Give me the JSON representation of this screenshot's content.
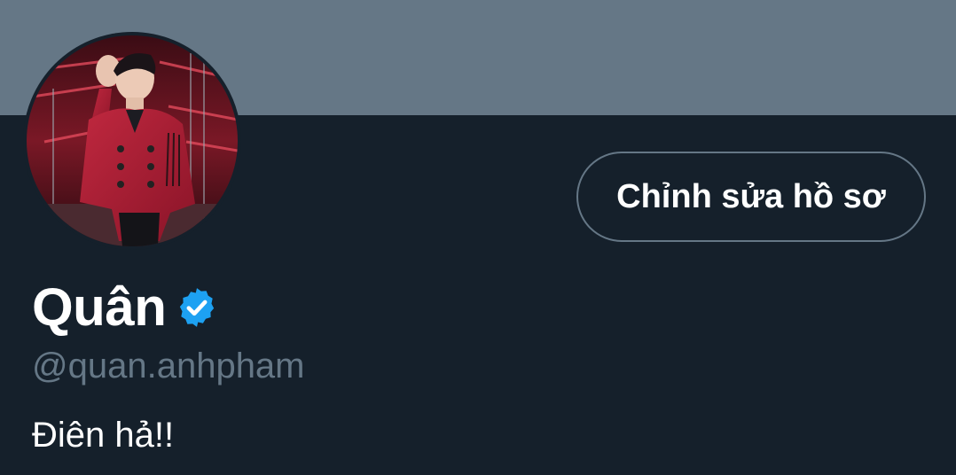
{
  "profile": {
    "display_name": "Quân",
    "verified_icon": "verified-badge-icon",
    "handle": "@quan.anhpham",
    "bio": "Điên hả!!",
    "edit_button_label": "Chỉnh sửa hồ sơ",
    "avatar_icon": "profile-photo"
  },
  "colors": {
    "background": "#15202b",
    "banner": "#657786",
    "verified": "#1da1f2",
    "handle": "#657786",
    "text": "#ffffff"
  }
}
